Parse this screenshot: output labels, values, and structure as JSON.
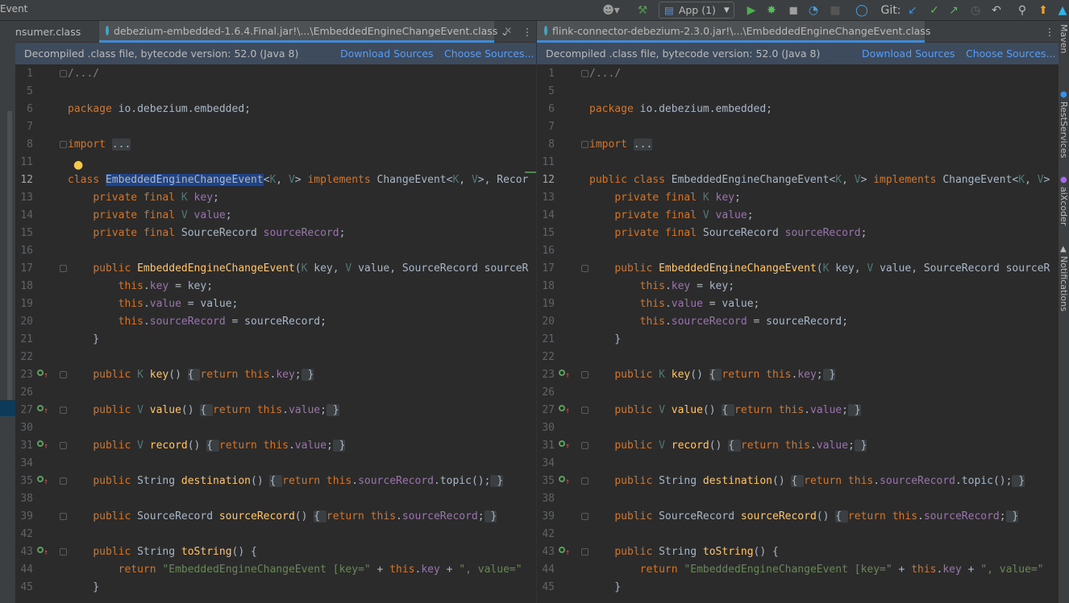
{
  "toolbar": {
    "title": "Event",
    "run_config": "App (1)",
    "git_label": "Git:",
    "icons": [
      "user-icon",
      "chevron-down-icon",
      "hammer-icon",
      "run-icon",
      "debug-icon",
      "coverage-icon",
      "profile-icon",
      "stop-icon",
      "update-icon",
      "git-update-icon",
      "git-commit-icon",
      "git-push-icon",
      "history-icon",
      "rollback-icon",
      "search-icon",
      "upgrade-icon",
      "jetbrains-icon"
    ]
  },
  "right_strip": {
    "labels": [
      "Maven",
      "RestServices",
      "aiXcoder",
      "Notifications"
    ]
  },
  "left_pane": {
    "tabs": [
      {
        "label": "nsumer.class"
      },
      {
        "label": "debezium-embedded-1.6.4.Final.jar!\\...\\EmbeddedEngineChangeEvent.class"
      }
    ],
    "notice": "Decompiled .class file, bytecode version: 52.0 (Java 8)",
    "download_sources": "Download Sources",
    "choose_sources": "Choose Sources..."
  },
  "right_pane": {
    "tabs": [
      {
        "label": "flink-connector-debezium-2.3.0.jar!\\...\\EmbeddedEngineChangeEvent.class"
      }
    ],
    "notice": "Decompiled .class file, bytecode version: 52.0 (Java 8)",
    "download_sources": "Download Sources",
    "choose_sources": "Choose Sources..."
  },
  "colors": {
    "keyword": "#cc7832",
    "field": "#9876aa",
    "string": "#6a8759",
    "method": "#ffc66d",
    "type_param": "#507874",
    "comment": "#808080",
    "text": "#a9b7c6",
    "link": "#589df6",
    "notice_bg": "#3d4b5c",
    "selection": "#214283"
  },
  "code_left": [
    {
      "n": "1",
      "fold": true,
      "t": [
        [
          "cm",
          "/.../"
        ]
      ]
    },
    {
      "n": "5",
      "t": []
    },
    {
      "n": "6",
      "t": [
        [
          "kw",
          "package "
        ],
        [
          "",
          "io.debezium.embedded;"
        ]
      ]
    },
    {
      "n": "7",
      "t": []
    },
    {
      "n": "8",
      "fold": true,
      "t": [
        [
          "kw",
          "import "
        ],
        [
          "fb",
          "..."
        ]
      ]
    },
    {
      "n": "11",
      "t": []
    },
    {
      "n": "12",
      "cur": true,
      "t": [
        [
          "kw",
          "class "
        ],
        [
          "hl",
          "EmbeddedEngineChangeEvent"
        ],
        [
          "",
          "<"
        ],
        [
          "tp",
          "K"
        ],
        [
          "",
          ", "
        ],
        [
          "tp",
          "V"
        ],
        [
          "",
          "> "
        ],
        [
          "kw",
          "implements "
        ],
        [
          "",
          "ChangeEvent<"
        ],
        [
          "tp",
          "K"
        ],
        [
          "",
          ", "
        ],
        [
          "tp",
          "V"
        ],
        [
          "",
          ">, Recor"
        ]
      ]
    },
    {
      "n": "13",
      "t": [
        [
          "",
          "    "
        ],
        [
          "kw",
          "private final "
        ],
        [
          "tp",
          "K "
        ],
        [
          "fld",
          "key"
        ],
        [
          "",
          ";"
        ]
      ]
    },
    {
      "n": "14",
      "t": [
        [
          "",
          "    "
        ],
        [
          "kw",
          "private final "
        ],
        [
          "tp",
          "V "
        ],
        [
          "fld",
          "value"
        ],
        [
          "",
          ";"
        ]
      ]
    },
    {
      "n": "15",
      "t": [
        [
          "",
          "    "
        ],
        [
          "kw",
          "private final "
        ],
        [
          "",
          "SourceRecord "
        ],
        [
          "fld",
          "sourceRecord"
        ],
        [
          "",
          ";"
        ]
      ]
    },
    {
      "n": "16",
      "t": []
    },
    {
      "n": "17",
      "fold": true,
      "t": [
        [
          "",
          "    "
        ],
        [
          "kw",
          "public "
        ],
        [
          "fn",
          "EmbeddedEngineChangeEvent"
        ],
        [
          "",
          "("
        ],
        [
          "tp",
          "K "
        ],
        [
          "",
          "key, "
        ],
        [
          "tp",
          "V "
        ],
        [
          "",
          "value, SourceRecord sourceR"
        ]
      ]
    },
    {
      "n": "18",
      "t": [
        [
          "",
          "        "
        ],
        [
          "kw",
          "this"
        ],
        [
          "",
          "."
        ],
        [
          "fld",
          "key"
        ],
        [
          "",
          " = key;"
        ]
      ]
    },
    {
      "n": "19",
      "t": [
        [
          "",
          "        "
        ],
        [
          "kw",
          "this"
        ],
        [
          "",
          "."
        ],
        [
          "fld",
          "value"
        ],
        [
          "",
          " = value;"
        ]
      ]
    },
    {
      "n": "20",
      "t": [
        [
          "",
          "        "
        ],
        [
          "kw",
          "this"
        ],
        [
          "",
          "."
        ],
        [
          "fld",
          "sourceRecord"
        ],
        [
          "",
          " = sourceRecord;"
        ]
      ]
    },
    {
      "n": "21",
      "t": [
        [
          "",
          "    }"
        ]
      ]
    },
    {
      "n": "22",
      "t": []
    },
    {
      "n": "23",
      "g": true,
      "fold": true,
      "t": [
        [
          "",
          "    "
        ],
        [
          "kw",
          "public "
        ],
        [
          "tp",
          "K "
        ],
        [
          "fn",
          "key"
        ],
        [
          "",
          "() "
        ],
        [
          "fb",
          "{ "
        ],
        [
          "kw",
          "return this"
        ],
        [
          "",
          "."
        ],
        [
          "fld",
          "key"
        ],
        [
          "",
          ";"
        ],
        [
          "fb",
          " }"
        ]
      ]
    },
    {
      "n": "26",
      "t": []
    },
    {
      "n": "27",
      "g": true,
      "fold": true,
      "t": [
        [
          "",
          "    "
        ],
        [
          "kw",
          "public "
        ],
        [
          "tp",
          "V "
        ],
        [
          "fn",
          "value"
        ],
        [
          "",
          "() "
        ],
        [
          "fb",
          "{ "
        ],
        [
          "kw",
          "return this"
        ],
        [
          "",
          "."
        ],
        [
          "fld",
          "value"
        ],
        [
          "",
          ";"
        ],
        [
          "fb",
          " }"
        ]
      ]
    },
    {
      "n": "30",
      "t": []
    },
    {
      "n": "31",
      "g": true,
      "fold": true,
      "t": [
        [
          "",
          "    "
        ],
        [
          "kw",
          "public "
        ],
        [
          "tp",
          "V "
        ],
        [
          "fn",
          "record"
        ],
        [
          "",
          "() "
        ],
        [
          "fb",
          "{ "
        ],
        [
          "kw",
          "return this"
        ],
        [
          "",
          "."
        ],
        [
          "fld",
          "value"
        ],
        [
          "",
          ";"
        ],
        [
          "fb",
          " }"
        ]
      ]
    },
    {
      "n": "34",
      "t": []
    },
    {
      "n": "35",
      "g": true,
      "fold": true,
      "t": [
        [
          "",
          "    "
        ],
        [
          "kw",
          "public "
        ],
        [
          "",
          "String "
        ],
        [
          "fn",
          "destination"
        ],
        [
          "",
          "() "
        ],
        [
          "fb",
          "{ "
        ],
        [
          "kw",
          "return this"
        ],
        [
          "",
          "."
        ],
        [
          "fld",
          "sourceRecord"
        ],
        [
          "",
          ".topic();"
        ],
        [
          "fb",
          " }"
        ]
      ]
    },
    {
      "n": "38",
      "t": []
    },
    {
      "n": "39",
      "fold": true,
      "t": [
        [
          "",
          "    "
        ],
        [
          "kw",
          "public "
        ],
        [
          "",
          "SourceRecord "
        ],
        [
          "fn",
          "sourceRecord"
        ],
        [
          "",
          "() "
        ],
        [
          "fb",
          "{ "
        ],
        [
          "kw",
          "return this"
        ],
        [
          "",
          "."
        ],
        [
          "fld",
          "sourceRecord"
        ],
        [
          "",
          ";"
        ],
        [
          "fb",
          " }"
        ]
      ]
    },
    {
      "n": "42",
      "t": []
    },
    {
      "n": "43",
      "g": true,
      "fold": true,
      "t": [
        [
          "",
          "    "
        ],
        [
          "kw",
          "public "
        ],
        [
          "",
          "String "
        ],
        [
          "fn",
          "toString"
        ],
        [
          "",
          "() {"
        ]
      ]
    },
    {
      "n": "44",
      "t": [
        [
          "",
          "        "
        ],
        [
          "kw",
          "return "
        ],
        [
          "str",
          "\"EmbeddedEngineChangeEvent [key=\""
        ],
        [
          "",
          " + "
        ],
        [
          "kw",
          "this"
        ],
        [
          "",
          "."
        ],
        [
          "fld",
          "key"
        ],
        [
          "",
          " + "
        ],
        [
          "str",
          "\", value=\""
        ]
      ]
    },
    {
      "n": "45",
      "t": [
        [
          "",
          "    }"
        ]
      ]
    }
  ],
  "code_right": [
    {
      "n": "1",
      "fold": true,
      "t": [
        [
          "cm",
          "/.../"
        ]
      ]
    },
    {
      "n": "5",
      "t": []
    },
    {
      "n": "6",
      "t": [
        [
          "kw",
          "package "
        ],
        [
          "",
          "io.debezium.embedded;"
        ]
      ]
    },
    {
      "n": "7",
      "t": []
    },
    {
      "n": "8",
      "fold": true,
      "t": [
        [
          "kw",
          "import "
        ],
        [
          "fb",
          "..."
        ]
      ]
    },
    {
      "n": "11",
      "t": []
    },
    {
      "n": "12",
      "cur": true,
      "t": [
        [
          "kw",
          "public class "
        ],
        [
          "",
          "EmbeddedEngineChangeEvent<"
        ],
        [
          "tp",
          "K"
        ],
        [
          "",
          ", "
        ],
        [
          "tp",
          "V"
        ],
        [
          "",
          "> "
        ],
        [
          "kw",
          "implements "
        ],
        [
          "",
          "ChangeEvent<"
        ],
        [
          "tp",
          "K"
        ],
        [
          "",
          ", "
        ],
        [
          "tp",
          "V"
        ],
        [
          "",
          ">"
        ]
      ]
    },
    {
      "n": "13",
      "t": [
        [
          "",
          "    "
        ],
        [
          "kw",
          "private final "
        ],
        [
          "tp",
          "K "
        ],
        [
          "fld",
          "key"
        ],
        [
          "",
          ";"
        ]
      ]
    },
    {
      "n": "14",
      "t": [
        [
          "",
          "    "
        ],
        [
          "kw",
          "private final "
        ],
        [
          "tp",
          "V "
        ],
        [
          "fld",
          "value"
        ],
        [
          "",
          ";"
        ]
      ]
    },
    {
      "n": "15",
      "t": [
        [
          "",
          "    "
        ],
        [
          "kw",
          "private final "
        ],
        [
          "",
          "SourceRecord "
        ],
        [
          "fld",
          "sourceRecord"
        ],
        [
          "",
          ";"
        ]
      ]
    },
    {
      "n": "16",
      "t": []
    },
    {
      "n": "17",
      "fold": true,
      "t": [
        [
          "",
          "    "
        ],
        [
          "kw",
          "public "
        ],
        [
          "fn",
          "EmbeddedEngineChangeEvent"
        ],
        [
          "",
          "("
        ],
        [
          "tp",
          "K "
        ],
        [
          "",
          "key, "
        ],
        [
          "tp",
          "V "
        ],
        [
          "",
          "value, SourceRecord sourceR"
        ]
      ]
    },
    {
      "n": "18",
      "t": [
        [
          "",
          "        "
        ],
        [
          "kw",
          "this"
        ],
        [
          "",
          "."
        ],
        [
          "fld",
          "key"
        ],
        [
          "",
          " = key;"
        ]
      ]
    },
    {
      "n": "19",
      "t": [
        [
          "",
          "        "
        ],
        [
          "kw",
          "this"
        ],
        [
          "",
          "."
        ],
        [
          "fld",
          "value"
        ],
        [
          "",
          " = value;"
        ]
      ]
    },
    {
      "n": "20",
      "t": [
        [
          "",
          "        "
        ],
        [
          "kw",
          "this"
        ],
        [
          "",
          "."
        ],
        [
          "fld",
          "sourceRecord"
        ],
        [
          "",
          " = sourceRecord;"
        ]
      ]
    },
    {
      "n": "21",
      "t": [
        [
          "",
          "    }"
        ]
      ]
    },
    {
      "n": "22",
      "t": []
    },
    {
      "n": "23",
      "g": true,
      "fold": true,
      "t": [
        [
          "",
          "    "
        ],
        [
          "kw",
          "public "
        ],
        [
          "tp",
          "K "
        ],
        [
          "fn",
          "key"
        ],
        [
          "",
          "() "
        ],
        [
          "fb",
          "{ "
        ],
        [
          "kw",
          "return this"
        ],
        [
          "",
          "."
        ],
        [
          "fld",
          "key"
        ],
        [
          "",
          ";"
        ],
        [
          "fb",
          " }"
        ]
      ]
    },
    {
      "n": "26",
      "t": []
    },
    {
      "n": "27",
      "g": true,
      "fold": true,
      "t": [
        [
          "",
          "    "
        ],
        [
          "kw",
          "public "
        ],
        [
          "tp",
          "V "
        ],
        [
          "fn",
          "value"
        ],
        [
          "",
          "() "
        ],
        [
          "fb",
          "{ "
        ],
        [
          "kw",
          "return this"
        ],
        [
          "",
          "."
        ],
        [
          "fld",
          "value"
        ],
        [
          "",
          ";"
        ],
        [
          "fb",
          " }"
        ]
      ]
    },
    {
      "n": "30",
      "t": []
    },
    {
      "n": "31",
      "g": true,
      "fold": true,
      "t": [
        [
          "",
          "    "
        ],
        [
          "kw",
          "public "
        ],
        [
          "tp",
          "V "
        ],
        [
          "fn",
          "record"
        ],
        [
          "",
          "() "
        ],
        [
          "fb",
          "{ "
        ],
        [
          "kw",
          "return this"
        ],
        [
          "",
          "."
        ],
        [
          "fld",
          "value"
        ],
        [
          "",
          ";"
        ],
        [
          "fb",
          " }"
        ]
      ]
    },
    {
      "n": "34",
      "t": []
    },
    {
      "n": "35",
      "g": true,
      "fold": true,
      "t": [
        [
          "",
          "    "
        ],
        [
          "kw",
          "public "
        ],
        [
          "",
          "String "
        ],
        [
          "fn",
          "destination"
        ],
        [
          "",
          "() "
        ],
        [
          "fb",
          "{ "
        ],
        [
          "kw",
          "return this"
        ],
        [
          "",
          "."
        ],
        [
          "fld",
          "sourceRecord"
        ],
        [
          "",
          ".topic();"
        ],
        [
          "fb",
          " }"
        ]
      ]
    },
    {
      "n": "38",
      "t": []
    },
    {
      "n": "39",
      "fold": true,
      "t": [
        [
          "",
          "    "
        ],
        [
          "kw",
          "public "
        ],
        [
          "",
          "SourceRecord "
        ],
        [
          "fn",
          "sourceRecord"
        ],
        [
          "",
          "() "
        ],
        [
          "fb",
          "{ "
        ],
        [
          "kw",
          "return this"
        ],
        [
          "",
          "."
        ],
        [
          "fld",
          "sourceRecord"
        ],
        [
          "",
          ";"
        ],
        [
          "fb",
          " }"
        ]
      ]
    },
    {
      "n": "42",
      "t": []
    },
    {
      "n": "43",
      "g": true,
      "fold": true,
      "t": [
        [
          "",
          "    "
        ],
        [
          "kw",
          "public "
        ],
        [
          "",
          "String "
        ],
        [
          "fn",
          "toString"
        ],
        [
          "",
          "() {"
        ]
      ]
    },
    {
      "n": "44",
      "t": [
        [
          "",
          "        "
        ],
        [
          "kw",
          "return "
        ],
        [
          "str",
          "\"EmbeddedEngineChangeEvent [key=\""
        ],
        [
          "",
          " + "
        ],
        [
          "kw",
          "this"
        ],
        [
          "",
          "."
        ],
        [
          "fld",
          "key"
        ],
        [
          "",
          " + "
        ],
        [
          "str",
          "\", value=\""
        ]
      ]
    },
    {
      "n": "45",
      "t": [
        [
          "",
          "    }"
        ]
      ]
    }
  ]
}
